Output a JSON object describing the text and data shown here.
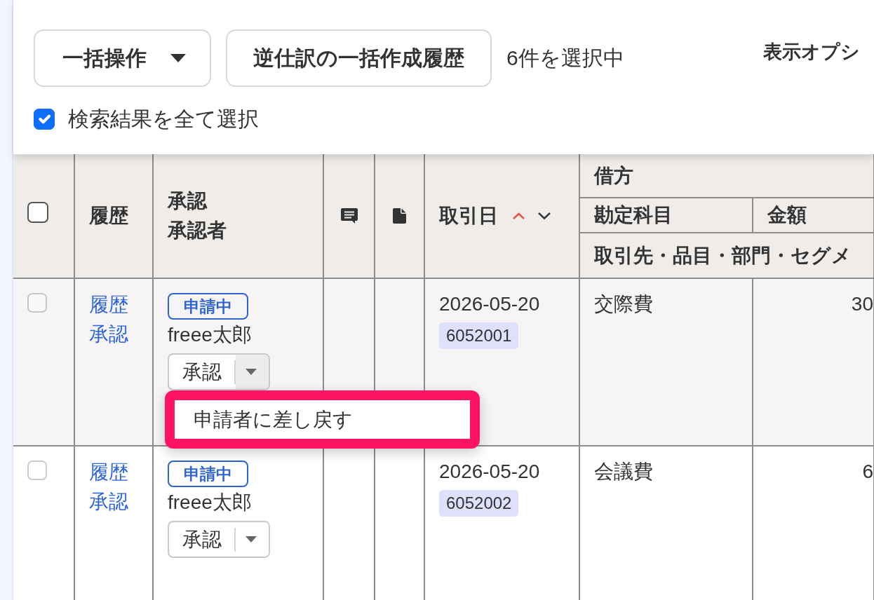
{
  "toolbar": {
    "bulk_button": {
      "label": "一括操作"
    },
    "history_button": {
      "label": "逆仕訳の一括作成履歴"
    },
    "selection_count": "6件を選択中",
    "display_options": "表示オプシ",
    "select_all": {
      "label": "検索結果を全て選択",
      "checked": true
    }
  },
  "table": {
    "columns": [
      {
        "kind": "checkbox",
        "checked": false
      },
      {
        "kind": "text",
        "lines": [
          "履歴"
        ]
      },
      {
        "kind": "text",
        "lines": [
          "承認",
          "承認者"
        ]
      },
      {
        "kind": "comment"
      },
      {
        "kind": "file"
      },
      {
        "kind": "sort",
        "label": "取引日",
        "ascending": true
      }
    ],
    "debit_group": {
      "label": "借方",
      "columns": [
        "勘定科目",
        "金額"
      ],
      "detail_label": "取引先・品目・部門・セグメ"
    },
    "rows": [
      {
        "checked": false,
        "disabled": true,
        "links": [
          "履歴",
          "承認"
        ],
        "status": "申請中",
        "approver": "freee太郎",
        "action": "承認",
        "menu_open": true,
        "date": "2026-05-20",
        "number": "6052001",
        "account": "交際費",
        "amount": "30"
      },
      {
        "checked": false,
        "disabled": true,
        "links": [
          "履歴",
          "承認"
        ],
        "status": "申請中",
        "approver": "freee太郎",
        "action": "承認",
        "menu_open": false,
        "date": "2026-05-20",
        "number": "6052002",
        "account": "会議費",
        "amount": "6"
      }
    ]
  },
  "approval_menu": {
    "items": [
      "申請者に差し戻す"
    ]
  }
}
